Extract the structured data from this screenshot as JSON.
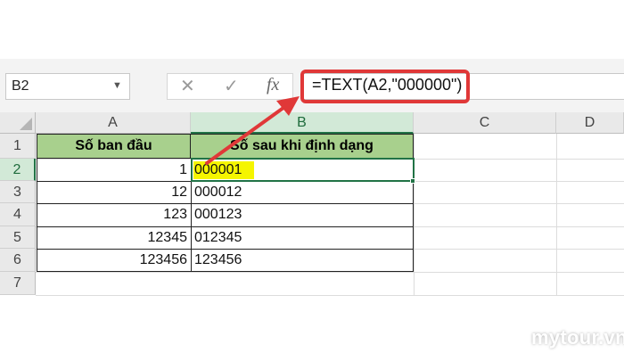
{
  "formula_bar": {
    "name_box": "B2",
    "cancel_icon": "x-icon",
    "enter_icon": "check-icon",
    "fx_label": "fx",
    "formula": "=TEXT(A2,\"000000\")"
  },
  "columns": [
    "A",
    "B",
    "C",
    "D"
  ],
  "rows": [
    "1",
    "2",
    "3",
    "4",
    "5",
    "6",
    "7"
  ],
  "table": {
    "header_a": "Số ban đầu",
    "header_b": "Số sau khi định dạng",
    "data": [
      {
        "a": "1",
        "b": "000001"
      },
      {
        "a": "12",
        "b": "000012"
      },
      {
        "a": "123",
        "b": "000123"
      },
      {
        "a": "12345",
        "b": "012345"
      },
      {
        "a": "123456",
        "b": "123456"
      }
    ]
  },
  "colors": {
    "header_fill": "#a8d08d",
    "highlight": "#f5f500",
    "callout": "#e03838",
    "selection": "#217346"
  },
  "watermark": "mytour.vn"
}
